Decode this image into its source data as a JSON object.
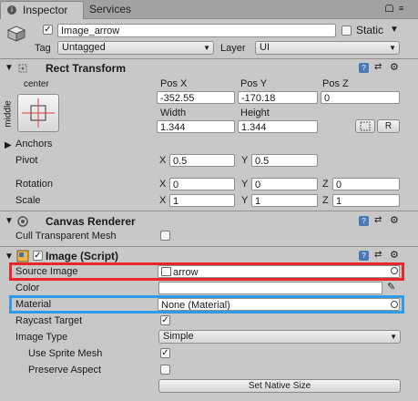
{
  "tabs": {
    "inspector": "Inspector",
    "services": "Services"
  },
  "header": {
    "object_name": "Image_arrow",
    "static_label": "Static",
    "tag_label": "Tag",
    "tag_value": "Untagged",
    "layer_label": "Layer",
    "layer_value": "UI"
  },
  "rect_transform": {
    "title": "Rect Transform",
    "anchor_horizontal": "center",
    "anchor_vertical": "middle",
    "pos_x_label": "Pos X",
    "pos_y_label": "Pos Y",
    "pos_z_label": "Pos Z",
    "pos_x": "-352.55",
    "pos_y": "-170.18",
    "pos_z": "0",
    "width_label": "Width",
    "height_label": "Height",
    "width": "1.344",
    "height": "1.344",
    "r_button": "R",
    "anchors_label": "Anchors",
    "pivot_label": "Pivot",
    "pivot_x": "0.5",
    "pivot_y": "0.5",
    "rotation_label": "Rotation",
    "rot_x": "0",
    "rot_y": "0",
    "rot_z": "0",
    "scale_label": "Scale",
    "scale_x": "1",
    "scale_y": "1",
    "scale_z": "1",
    "x": "X",
    "y": "Y",
    "z": "Z"
  },
  "canvas_renderer": {
    "title": "Canvas Renderer",
    "cull_label": "Cull Transparent Mesh"
  },
  "image": {
    "title": "Image (Script)",
    "source_image_label": "Source Image",
    "source_image_value": "arrow",
    "color_label": "Color",
    "material_label": "Material",
    "material_value": "None (Material)",
    "raycast_label": "Raycast Target",
    "image_type_label": "Image Type",
    "image_type_value": "Simple",
    "use_sprite_mesh_label": "Use Sprite Mesh",
    "preserve_aspect_label": "Preserve Aspect",
    "set_native_size": "Set Native Size"
  },
  "colors": {
    "highlight_red": "#e8262c",
    "highlight_blue": "#2f9be6",
    "panel": "#c8c8c8"
  }
}
